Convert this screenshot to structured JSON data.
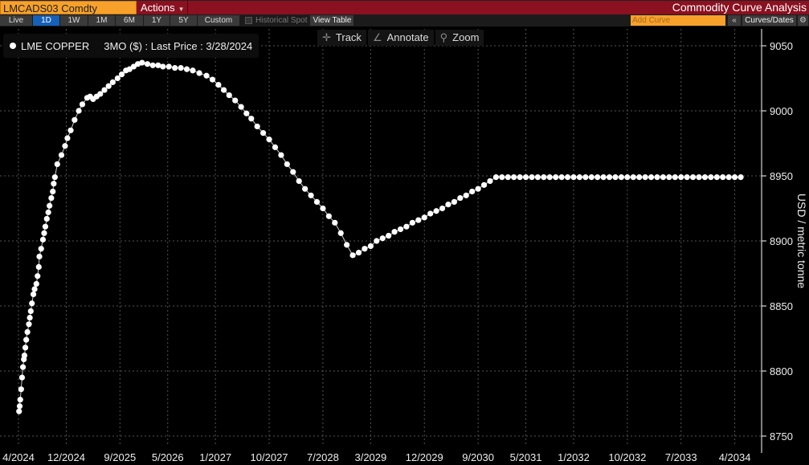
{
  "header": {
    "ticker": "LMCADS03 Comdty",
    "actions": "Actions",
    "app_title": "Commodity Curve Analysis"
  },
  "toolbar": {
    "ranges": [
      "Live",
      "1D",
      "1W",
      "1M",
      "6M",
      "1Y",
      "5Y",
      "Custom"
    ],
    "selected": "1D",
    "historical_spot": "Historical Spot",
    "view_table": "View Table",
    "add_curve_placeholder": "Add Curve",
    "collapse": "«",
    "curves_dates": "Curves/Dates",
    "settings": "⚙"
  },
  "tools": {
    "track": "Track",
    "annotate": "Annotate",
    "zoom": "Zoom"
  },
  "legend": {
    "name": "LME COPPER",
    "tenor": "3MO ($)",
    "desc": ": Last Price : 3/28/2024"
  },
  "colors": {
    "series": "#ffffff",
    "header_red": "#8b1020",
    "ticker_orange": "#f7a12a",
    "selected_blue": "#1560b8"
  },
  "chart_data": {
    "type": "scatter",
    "title": "LME COPPER 3MO ($) : Last Price : 3/28/2024",
    "xlabel": "",
    "ylabel": "USD / metric tonne",
    "x_unit": "months since 4/2024",
    "xlim": [
      -3,
      125
    ],
    "ylim": [
      8740,
      9060
    ],
    "yticks": [
      8750,
      8800,
      8850,
      8900,
      8950,
      9000,
      9050
    ],
    "xticks": [
      {
        "m": 0,
        "label": "4/2024"
      },
      {
        "m": 8,
        "label": "12/2024"
      },
      {
        "m": 17,
        "label": "9/2025"
      },
      {
        "m": 25,
        "label": "5/2026"
      },
      {
        "m": 33,
        "label": "1/2027"
      },
      {
        "m": 42,
        "label": "10/2027"
      },
      {
        "m": 51,
        "label": "7/2028"
      },
      {
        "m": 59,
        "label": "3/2029"
      },
      {
        "m": 68,
        "label": "12/2029"
      },
      {
        "m": 77,
        "label": "9/2030"
      },
      {
        "m": 85,
        "label": "5/2031"
      },
      {
        "m": 93,
        "label": "1/2032"
      },
      {
        "m": 102,
        "label": "10/2032"
      },
      {
        "m": 111,
        "label": "7/2033"
      },
      {
        "m": 120,
        "label": "4/2034"
      }
    ],
    "grid": true,
    "points": [
      [
        0.1,
        8769
      ],
      [
        0.2,
        8773
      ],
      [
        0.3,
        8778
      ],
      [
        0.45,
        8786
      ],
      [
        0.6,
        8795
      ],
      [
        0.75,
        8803
      ],
      [
        0.9,
        8809
      ],
      [
        1.0,
        8812
      ],
      [
        1.15,
        8818
      ],
      [
        1.3,
        8824
      ],
      [
        1.5,
        8830
      ],
      [
        1.75,
        8836
      ],
      [
        1.9,
        8841
      ],
      [
        2.06,
        8846
      ],
      [
        2.25,
        8852
      ],
      [
        2.5,
        8859
      ],
      [
        2.7,
        8863
      ],
      [
        3.0,
        8867
      ],
      [
        3.2,
        8873
      ],
      [
        3.4,
        8880
      ],
      [
        3.5,
        8888
      ],
      [
        3.8,
        8894
      ],
      [
        4.1,
        8901
      ],
      [
        4.3,
        8906
      ],
      [
        4.5,
        8911
      ],
      [
        4.75,
        8917
      ],
      [
        5.0,
        8922
      ],
      [
        5.2,
        8927
      ],
      [
        5.5,
        8933
      ],
      [
        5.75,
        8938
      ],
      [
        5.9,
        8944
      ],
      [
        6.1,
        8949
      ],
      [
        6.5,
        8959
      ],
      [
        7.2,
        8966
      ],
      [
        7.8,
        8973
      ],
      [
        8.2,
        8979
      ],
      [
        8.75,
        8985
      ],
      [
        9.4,
        8993
      ],
      [
        10.1,
        9000
      ],
      [
        10.7,
        9005
      ],
      [
        11.5,
        9010
      ],
      [
        12.0,
        9011
      ],
      [
        12.5,
        9009
      ],
      [
        13.1,
        9011
      ],
      [
        13.7,
        9013
      ],
      [
        14.4,
        9016
      ],
      [
        15.1,
        9019
      ],
      [
        15.8,
        9022
      ],
      [
        16.6,
        9025
      ],
      [
        17.3,
        9028
      ],
      [
        18.0,
        9031
      ],
      [
        18.6,
        9032
      ],
      [
        19.3,
        9034
      ],
      [
        20.0,
        9036
      ],
      [
        20.7,
        9037
      ],
      [
        21.6,
        9036
      ],
      [
        22.5,
        9035
      ],
      [
        23.4,
        9035
      ],
      [
        24.2,
        9034
      ],
      [
        25.2,
        9034
      ],
      [
        26.2,
        9033
      ],
      [
        27.2,
        9033
      ],
      [
        28.2,
        9032
      ],
      [
        29.2,
        9031
      ],
      [
        30.3,
        9029
      ],
      [
        31.5,
        9027
      ],
      [
        32.5,
        9024
      ],
      [
        33.5,
        9020
      ],
      [
        34.4,
        9016
      ],
      [
        35.3,
        9012
      ],
      [
        36.3,
        9008
      ],
      [
        37.3,
        9003
      ],
      [
        38.2,
        8998
      ],
      [
        39,
        8994
      ],
      [
        40,
        8988
      ],
      [
        41,
        8983
      ],
      [
        42,
        8978
      ],
      [
        43,
        8972
      ],
      [
        44,
        8966
      ],
      [
        45,
        8959
      ],
      [
        46,
        8953
      ],
      [
        47,
        8946
      ],
      [
        48,
        8940
      ],
      [
        49,
        8935
      ],
      [
        50,
        8930
      ],
      [
        51,
        8925
      ],
      [
        52,
        8919
      ],
      [
        53,
        8914
      ],
      [
        54,
        8906
      ],
      [
        55,
        8897
      ],
      [
        56,
        8889
      ],
      [
        57,
        8891
      ],
      [
        58,
        8894
      ],
      [
        59,
        8896
      ],
      [
        60,
        8900
      ],
      [
        61,
        8902
      ],
      [
        62,
        8904
      ],
      [
        63,
        8907
      ],
      [
        64,
        8909
      ],
      [
        65,
        8911
      ],
      [
        66,
        8914
      ],
      [
        67,
        8916
      ],
      [
        68,
        8918
      ],
      [
        69,
        8921
      ],
      [
        70,
        8923
      ],
      [
        71,
        8925
      ],
      [
        72,
        8928
      ],
      [
        73,
        8930
      ],
      [
        74,
        8933
      ],
      [
        75,
        8935
      ],
      [
        76,
        8938
      ],
      [
        77,
        8940
      ],
      [
        78,
        8943
      ],
      [
        79,
        8946
      ],
      [
        80,
        8949
      ],
      [
        81,
        8949
      ],
      [
        82,
        8949
      ],
      [
        83,
        8949
      ],
      [
        84,
        8949
      ],
      [
        85,
        8949
      ],
      [
        86,
        8949
      ],
      [
        87,
        8949
      ],
      [
        88,
        8949
      ],
      [
        89,
        8949
      ],
      [
        90,
        8949
      ],
      [
        91,
        8949
      ],
      [
        92,
        8949
      ],
      [
        93,
        8949
      ],
      [
        94,
        8949
      ],
      [
        95,
        8949
      ],
      [
        96,
        8949
      ],
      [
        97,
        8949
      ],
      [
        98,
        8949
      ],
      [
        99,
        8949
      ],
      [
        100,
        8949
      ],
      [
        101,
        8949
      ],
      [
        102,
        8949
      ],
      [
        103,
        8949
      ],
      [
        104,
        8949
      ],
      [
        105,
        8949
      ],
      [
        106,
        8949
      ],
      [
        107,
        8949
      ],
      [
        108,
        8949
      ],
      [
        109,
        8949
      ],
      [
        110,
        8949
      ],
      [
        111,
        8949
      ],
      [
        112,
        8949
      ],
      [
        113,
        8949
      ],
      [
        114,
        8949
      ],
      [
        115,
        8949
      ],
      [
        116,
        8949
      ],
      [
        117,
        8949
      ],
      [
        118,
        8949
      ],
      [
        119,
        8949
      ],
      [
        120,
        8949
      ],
      [
        121,
        8949
      ]
    ]
  }
}
